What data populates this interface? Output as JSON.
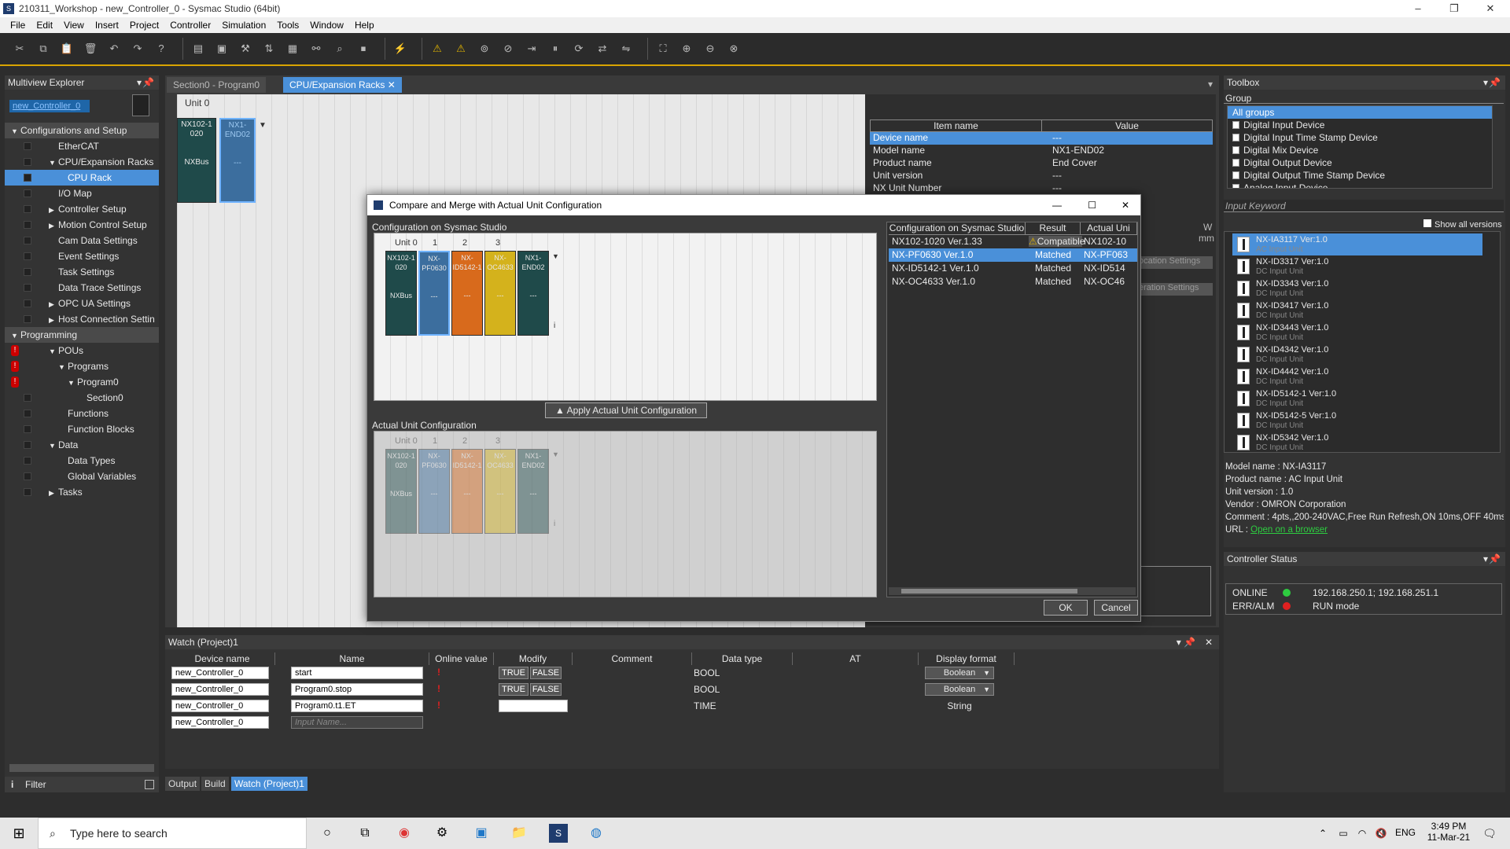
{
  "window": {
    "title": "210311_Workshop - new_Controller_0 - Sysmac Studio (64bit)"
  },
  "menu": [
    "File",
    "Edit",
    "View",
    "Insert",
    "Project",
    "Controller",
    "Simulation",
    "Tools",
    "Window",
    "Help"
  ],
  "explorer": {
    "title": "Multiview Explorer",
    "controller": "new_Controller_0",
    "filter": "Filter",
    "items": [
      {
        "label": "Configurations and Setup",
        "level": 0,
        "section": true,
        "expand": "▼"
      },
      {
        "label": "EtherCAT",
        "level": 2,
        "expand": ""
      },
      {
        "label": "CPU/Expansion Racks",
        "level": 2,
        "expand": "▼"
      },
      {
        "label": "CPU Rack",
        "level": 3,
        "expand": "",
        "selected": true
      },
      {
        "label": "I/O Map",
        "level": 2,
        "expand": ""
      },
      {
        "label": "Controller Setup",
        "level": 2,
        "expand": "▶"
      },
      {
        "label": "Motion Control Setup",
        "level": 2,
        "expand": "▶"
      },
      {
        "label": "Cam Data Settings",
        "level": 2,
        "expand": ""
      },
      {
        "label": "Event Settings",
        "level": 2,
        "expand": ""
      },
      {
        "label": "Task Settings",
        "level": 2,
        "expand": ""
      },
      {
        "label": "Data Trace Settings",
        "level": 2,
        "expand": ""
      },
      {
        "label": "OPC UA Settings",
        "level": 2,
        "expand": "▶"
      },
      {
        "label": "Host Connection Settin",
        "level": 2,
        "expand": "▶"
      },
      {
        "label": "Programming",
        "level": 0,
        "section": true,
        "expand": "▼"
      },
      {
        "label": "POUs",
        "level": 2,
        "expand": "▼",
        "error": true
      },
      {
        "label": "Programs",
        "level": 3,
        "expand": "▼",
        "error": true
      },
      {
        "label": "Program0",
        "level": 4,
        "expand": "▼",
        "error": true
      },
      {
        "label": "Section0",
        "level": 5,
        "expand": ""
      },
      {
        "label": "Functions",
        "level": 3,
        "expand": ""
      },
      {
        "label": "Function Blocks",
        "level": 3,
        "expand": ""
      },
      {
        "label": "Data",
        "level": 2,
        "expand": "▼"
      },
      {
        "label": "Data Types",
        "level": 3,
        "expand": ""
      },
      {
        "label": "Global Variables",
        "level": 3,
        "expand": ""
      },
      {
        "label": "Tasks",
        "level": 2,
        "expand": "▶"
      }
    ]
  },
  "editor": {
    "tabs": [
      "Section0 - Program0",
      "CPU/Expansion Racks"
    ],
    "unit_label": "Unit 0",
    "cpu_unit": {
      "model": "NX102-1\n020",
      "bus": "NXBus"
    },
    "end_cover": {
      "model": "NX1-\nEND02",
      "dash": "---"
    },
    "props_headers": [
      "Item name",
      "Value"
    ],
    "props_rows": [
      {
        "name": "Device name",
        "value": "---"
      },
      {
        "name": "Model name",
        "value": "NX1-END02"
      },
      {
        "name": "Product name",
        "value": "End Cover"
      },
      {
        "name": "Unit version",
        "value": "---"
      },
      {
        "name": "NX Unit Number",
        "value": "---"
      }
    ],
    "props_extra": [
      "W",
      "mm",
      "ocation Settings",
      "eration Settings"
    ]
  },
  "dialog": {
    "title": "Compare and Merge with Actual Unit Configuration",
    "sysmac_label": "Configuration on Sysmac Studio",
    "actual_label": "Actual Unit Configuration",
    "unit_headers": [
      "Unit 0",
      "1",
      "2",
      "3"
    ],
    "units": [
      {
        "model": "NX102-1\n020",
        "extra": "NXBus",
        "color": "#1f4a4a"
      },
      {
        "model": "NX-\nPF0630",
        "extra": "---",
        "color": "#3c6e9e"
      },
      {
        "model": "NX-\nID5142-1",
        "extra": "---",
        "color": "#d86a1c"
      },
      {
        "model": "NX-\nOC4633",
        "extra": "---",
        "color": "#d4b21c"
      },
      {
        "model": "NX1-\nEND02",
        "extra": "---",
        "color": "#1f4a4a"
      }
    ],
    "apply_button": "Apply Actual Unit Configuration",
    "compare_headers": [
      "Configuration on Sysmac Studio",
      "Result",
      "Actual Uni"
    ],
    "compare_rows": [
      {
        "config": "NX102-1020 Ver.1.33",
        "result": "Compatible",
        "actual": "NX102-10",
        "warn": true
      },
      {
        "config": "NX-PF0630 Ver.1.0",
        "result": "Matched",
        "actual": "NX-PF063",
        "selected": true
      },
      {
        "config": "NX-ID5142-1 Ver.1.0",
        "result": "Matched",
        "actual": "NX-ID514"
      },
      {
        "config": "NX-OC4633 Ver.1.0",
        "result": "Matched",
        "actual": "NX-OC46"
      }
    ],
    "ok": "OK",
    "cancel": "Cancel"
  },
  "watch": {
    "title": "Watch (Project)1",
    "headers": [
      "Device name",
      "Name",
      "Online value",
      "Modify",
      "Comment",
      "Data type",
      "AT",
      "Display format"
    ],
    "rows": [
      {
        "device": "new_Controller_0",
        "name": "start",
        "type": "BOOL",
        "format": "Boolean",
        "modify": true
      },
      {
        "device": "new_Controller_0",
        "name": "Program0.stop",
        "type": "BOOL",
        "format": "Boolean",
        "modify": true
      },
      {
        "device": "new_Controller_0",
        "name": "Program0.t1.ET",
        "type": "TIME",
        "format": "String",
        "modify": false
      },
      {
        "device": "new_Controller_0",
        "name": "",
        "placeholder": "Input Name...",
        "type": "",
        "format": "",
        "modify": false
      }
    ],
    "true_label": "TRUE",
    "false_label": "FALSE"
  },
  "bottom_tabs": [
    "Output",
    "Build",
    "Watch (Project)1"
  ],
  "toolbox": {
    "title": "Toolbox",
    "group_label": "Group",
    "groups": [
      "All groups",
      "Digital Input Device",
      "Digital Input Time Stamp Device",
      "Digital Mix Device",
      "Digital Output Device",
      "Digital Output Time Stamp Device",
      "Analog Input Device"
    ],
    "keyword_placeholder": "Input Keyword",
    "show_all": "Show all versions",
    "items": [
      {
        "name": "NX-IA3117 Ver:1.0",
        "sub": "AC Input Unit"
      },
      {
        "name": "NX-ID3317 Ver:1.0",
        "sub": "DC Input Unit"
      },
      {
        "name": "NX-ID3343 Ver:1.0",
        "sub": "DC Input Unit"
      },
      {
        "name": "NX-ID3417 Ver:1.0",
        "sub": "DC Input Unit"
      },
      {
        "name": "NX-ID3443 Ver:1.0",
        "sub": "DC Input Unit"
      },
      {
        "name": "NX-ID4342 Ver:1.0",
        "sub": "DC Input Unit"
      },
      {
        "name": "NX-ID4442 Ver:1.0",
        "sub": "DC Input Unit"
      },
      {
        "name": "NX-ID5142-1 Ver:1.0",
        "sub": "DC Input Unit"
      },
      {
        "name": "NX-ID5142-5 Ver:1.0",
        "sub": "DC Input Unit"
      },
      {
        "name": "NX-ID5342 Ver:1.0",
        "sub": "DC Input Unit"
      }
    ],
    "info": {
      "model": "Model name : NX-IA3117",
      "product": "Product name : AC Input Unit",
      "version": "Unit version : 1.0",
      "vendor": "Vendor :  OMRON Corporation",
      "comment": "Comment : 4pts,,200-240VAC,Free Run Refresh,ON 10ms,OFF 40ms",
      "url_label": "URL : ",
      "url_link": "Open on a browser"
    }
  },
  "controller_status": {
    "title": "Controller Status",
    "online_label": "ONLINE",
    "online_value": "192.168.250.1; 192.168.251.1",
    "err_label": "ERR/ALM",
    "err_value": "RUN mode"
  },
  "taskbar": {
    "search_placeholder": "Type here to search",
    "lang": "ENG",
    "time": "3:49 PM",
    "date": "11-Mar-21"
  },
  "colors": {
    "accent": "#4a90d9",
    "toolbar_border": "#d9a400",
    "online": "#2ecc40",
    "err": "#e02020"
  }
}
